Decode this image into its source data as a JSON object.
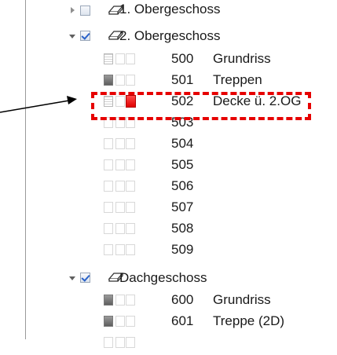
{
  "tree": {
    "floors": [
      {
        "label": "1. Obergeschoss",
        "expanded": false,
        "checked": false
      },
      {
        "label": "2. Obergeschoss",
        "expanded": true,
        "checked": true
      },
      {
        "label": "Dachgeschoss",
        "expanded": true,
        "checked": true
      }
    ],
    "layers_og2": [
      {
        "num": "500",
        "name": "Grundriss",
        "icons": [
          "grid",
          "dim",
          "dim"
        ]
      },
      {
        "num": "501",
        "name": "Treppen",
        "icons": [
          "dark",
          "dim",
          "dim"
        ]
      },
      {
        "num": "502",
        "name": "Decke ü. 2.OG",
        "icons": [
          "grid",
          "dim",
          "red"
        ]
      },
      {
        "num": "503",
        "name": "",
        "icons": [
          "dim",
          "dim",
          "dim"
        ]
      },
      {
        "num": "504",
        "name": "",
        "icons": [
          "dim",
          "dim",
          "dim"
        ]
      },
      {
        "num": "505",
        "name": "",
        "icons": [
          "dim",
          "dim",
          "dim"
        ]
      },
      {
        "num": "506",
        "name": "",
        "icons": [
          "dim",
          "dim",
          "dim"
        ]
      },
      {
        "num": "507",
        "name": "",
        "icons": [
          "dim",
          "dim",
          "dim"
        ]
      },
      {
        "num": "508",
        "name": "",
        "icons": [
          "dim",
          "dim",
          "dim"
        ]
      },
      {
        "num": "509",
        "name": "",
        "icons": [
          "dim",
          "dim",
          "dim"
        ]
      }
    ],
    "layers_dg": [
      {
        "num": "600",
        "name": "Grundriss",
        "icons": [
          "dark",
          "dim",
          "dim"
        ]
      },
      {
        "num": "601",
        "name": "Treppe (2D)",
        "icons": [
          "dark",
          "dim",
          "dim"
        ]
      }
    ]
  },
  "colors": {
    "highlight": "#e60000",
    "arrow": "#000000"
  }
}
